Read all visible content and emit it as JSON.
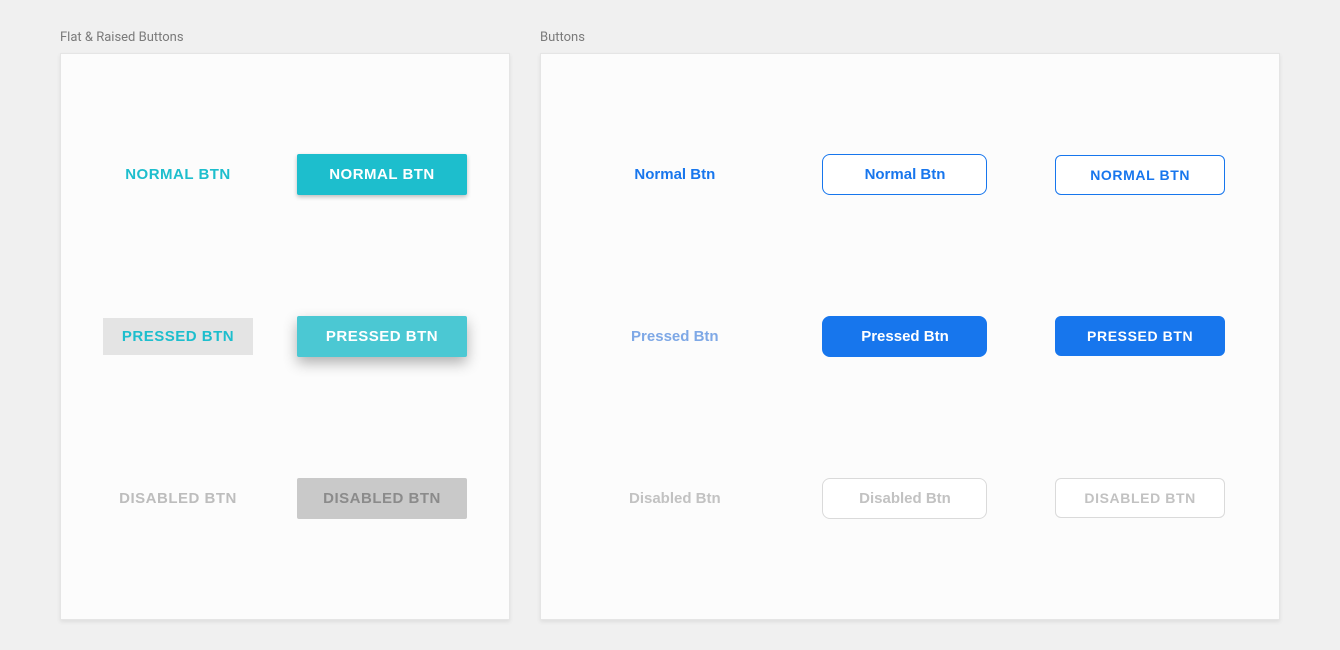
{
  "left": {
    "title": "Flat & Raised Buttons",
    "rows": [
      {
        "flat": "NORMAL BTN",
        "raised": "NORMAL BTN"
      },
      {
        "flat": "PRESSED BTN",
        "raised": "PRESSED BTN"
      },
      {
        "flat": "DISABLED BTN",
        "raised": "DISABLED BTN"
      }
    ]
  },
  "right": {
    "title": "Buttons",
    "rows": [
      {
        "text": "Normal Btn",
        "outline": "Normal Btn",
        "caps": "NORMAL BTN"
      },
      {
        "text": "Pressed Btn",
        "outline": "Pressed Btn",
        "caps": "PRESSED BTN"
      },
      {
        "text": "Disabled Btn",
        "outline": "Disabled Btn",
        "caps": "DISABLED BTN"
      }
    ]
  },
  "colors": {
    "teal": "#1dbecd",
    "teal_light": "#4bc8d3",
    "blue": "#1776ed",
    "blue_faded": "#7ea8e6",
    "disabled_text": "#c2c2c2",
    "disabled_fill": "#c9c9c9",
    "page_bg": "#f0f0f0"
  }
}
